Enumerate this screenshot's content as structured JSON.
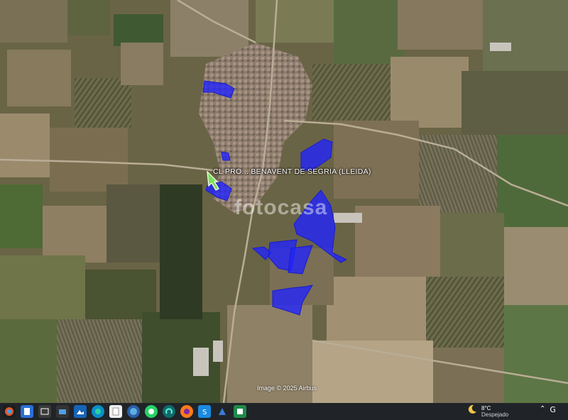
{
  "map": {
    "type": "satellite",
    "place_label": "CL PRO... BENAVENT DE SEGRIA (LLEIDA)",
    "watermark": "fotocasa",
    "attribution": "Image © 2025 Airbus",
    "highlight_color": "#1f22ff",
    "pin_color": "#7ce05a"
  },
  "taskbar": {
    "icons": [
      "windows-start-icon",
      "notes-icon",
      "window-icon",
      "image-viewer-icon",
      "photos-icon",
      "edge-icon",
      "file-icon",
      "globe-icon",
      "whatsapp-icon",
      "app-icon",
      "firefox-icon",
      "store-icon",
      "triangle-app-icon",
      "app-icon-2"
    ],
    "weather": {
      "temperature": "8°C",
      "condition": "Despejado"
    }
  }
}
